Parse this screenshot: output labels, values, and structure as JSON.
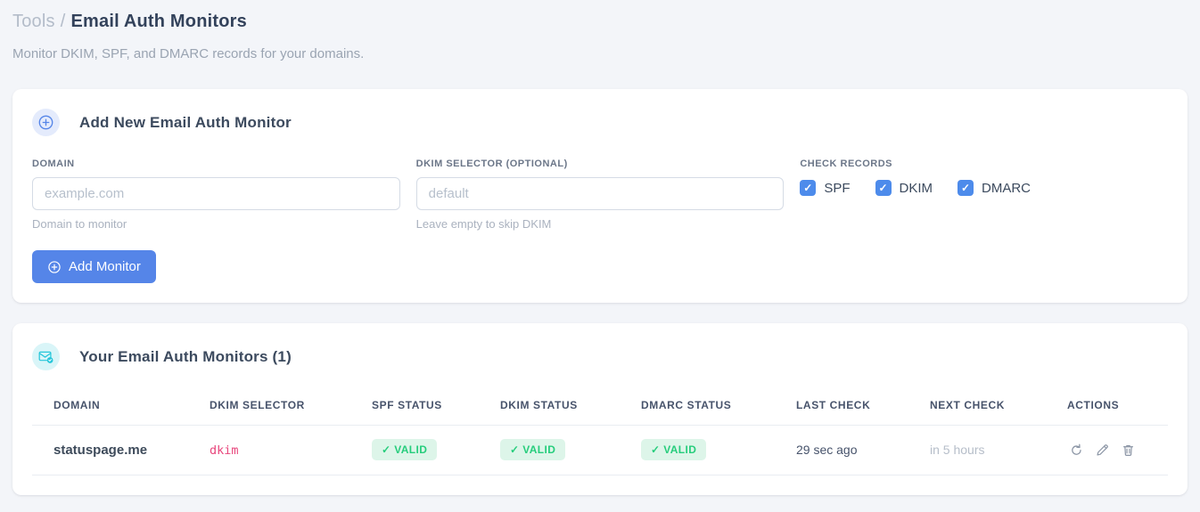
{
  "page": {
    "breadcrumb": {
      "parent": "Tools",
      "separator": "/",
      "current": "Email Auth Monitors"
    },
    "subtitle": "Monitor DKIM, SPF, and DMARC records for your domains."
  },
  "add_card": {
    "title": "Add New Email Auth Monitor",
    "domain_field": {
      "label": "DOMAIN",
      "placeholder": "example.com",
      "value": "",
      "helper": "Domain to monitor"
    },
    "dkim_field": {
      "label": "DKIM SELECTOR (OPTIONAL)",
      "placeholder": "default",
      "value": "",
      "helper": "Leave empty to skip DKIM"
    },
    "check_records": {
      "label": "CHECK RECORDS",
      "options": [
        {
          "label": "SPF",
          "checked": true
        },
        {
          "label": "DKIM",
          "checked": true
        },
        {
          "label": "DMARC",
          "checked": true
        }
      ]
    },
    "submit_button": "Add Monitor"
  },
  "monitors_card": {
    "title": "Your Email Auth Monitors (1)",
    "headers": [
      "DOMAIN",
      "DKIM SELECTOR",
      "SPF STATUS",
      "DKIM STATUS",
      "DMARC STATUS",
      "LAST CHECK",
      "NEXT CHECK",
      "ACTIONS"
    ],
    "rows": [
      {
        "domain": "statuspage.me",
        "dkim_selector": "dkim",
        "spf_status": "✓ VALID",
        "dkim_status": "✓ VALID",
        "dmarc_status": "✓ VALID",
        "last_check": "29 sec ago",
        "next_check": "in 5 hours"
      }
    ]
  },
  "colors": {
    "accent_blue": "#5585e8",
    "checkbox_blue": "#4d8beb",
    "teal": "#26c6da",
    "valid_text": "#26cd7c",
    "valid_bg": "#ddf5e9",
    "code_pink": "#e8467c",
    "page_bg": "#f3f5f9"
  }
}
